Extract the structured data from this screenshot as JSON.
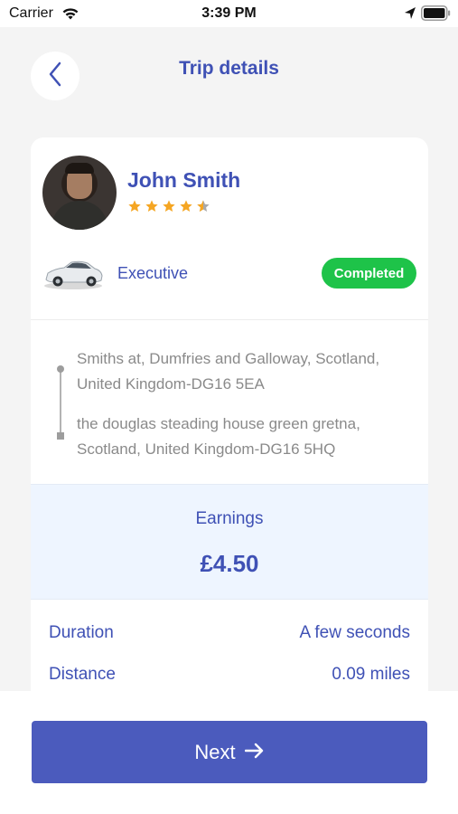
{
  "status_bar": {
    "carrier": "Carrier",
    "time": "3:39 PM",
    "icons": [
      "wifi-icon",
      "location-arrow-icon",
      "battery-icon"
    ]
  },
  "header": {
    "title": "Trip details",
    "back_icon": "chevron-left-icon"
  },
  "driver": {
    "name": "John Smith",
    "rating": 4.5,
    "rating_max": 5
  },
  "vehicle": {
    "type": "Executive",
    "icon": "car-icon"
  },
  "trip_status": "Completed",
  "route": {
    "pickup": "Smiths at, Dumfries and Galloway, Scotland, United Kingdom-DG16 5EA",
    "dropoff": "the douglas steading house green gretna, Scotland, United Kingdom-DG16 5HQ"
  },
  "earnings": {
    "label": "Earnings",
    "amount": "£4.50"
  },
  "details": [
    {
      "label": "Duration",
      "value": "A few seconds"
    },
    {
      "label": "Distance",
      "value": "0.09 miles"
    }
  ],
  "actions": {
    "next_label": "Next",
    "next_icon": "arrow-right-icon"
  },
  "colors": {
    "brand": "#3f51b5",
    "button": "#4b5bbd",
    "status_completed": "#1ec349",
    "star": "#f5a623"
  }
}
